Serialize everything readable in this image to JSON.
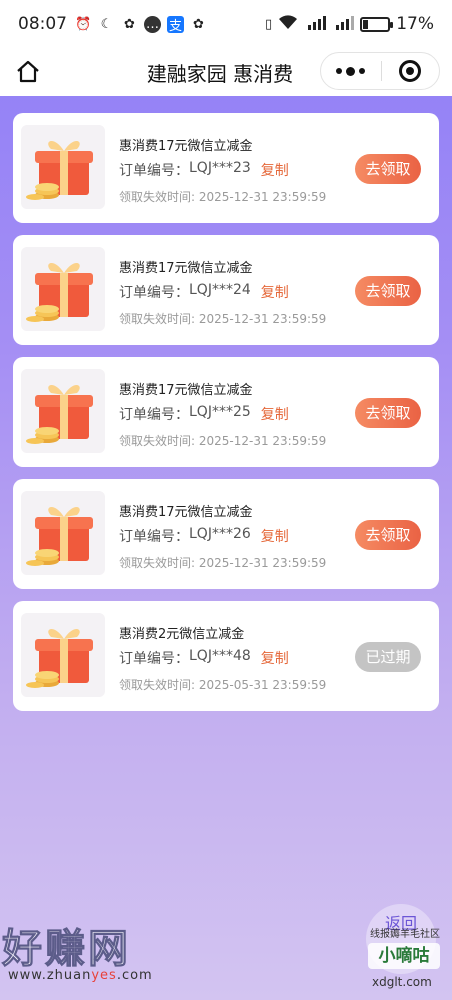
{
  "status_bar": {
    "time": "08:07",
    "battery_percent": "17%",
    "battery_level": 0.17
  },
  "navbar": {
    "title": "建融家园 惠消费"
  },
  "coupons": [
    {
      "title": "惠消费17元微信立减金",
      "order_label": "订单编号：",
      "order_no": "LQJ***23",
      "copy_label": "复制",
      "expire_label": "领取失效时间: ",
      "expire_time": "2025-12-31 23:59:59",
      "action_label": "去领取",
      "expired": false
    },
    {
      "title": "惠消费17元微信立减金",
      "order_label": "订单编号：",
      "order_no": "LQJ***24",
      "copy_label": "复制",
      "expire_label": "领取失效时间: ",
      "expire_time": "2025-12-31 23:59:59",
      "action_label": "去领取",
      "expired": false
    },
    {
      "title": "惠消费17元微信立减金",
      "order_label": "订单编号：",
      "order_no": "LQJ***25",
      "copy_label": "复制",
      "expire_label": "领取失效时间: ",
      "expire_time": "2025-12-31 23:59:59",
      "action_label": "去领取",
      "expired": false
    },
    {
      "title": "惠消费17元微信立减金",
      "order_label": "订单编号：",
      "order_no": "LQJ***26",
      "copy_label": "复制",
      "expire_label": "领取失效时间: ",
      "expire_time": "2025-12-31 23:59:59",
      "action_label": "去领取",
      "expired": false
    },
    {
      "title": "惠消费2元微信立减金",
      "order_label": "订单编号：",
      "order_no": "LQJ***48",
      "copy_label": "复制",
      "expire_label": "领取失效时间: ",
      "expire_time": "2025-05-31 23:59:59",
      "action_label": "已过期",
      "expired": true
    }
  ],
  "float_button": {
    "label": "返回"
  },
  "watermark": {
    "brand": "好赚网",
    "url_prefix": "www.zhuan",
    "url_highlight": "yes",
    "url_suffix": ".com",
    "community": "线报薅羊毛社区",
    "community_name": "小嘀咕",
    "community_url": "xdglt.com"
  },
  "colors": {
    "accent_orange": "#ea6244",
    "expired_gray": "#c4c4c4",
    "bg_purple": "#8f7ef7"
  }
}
